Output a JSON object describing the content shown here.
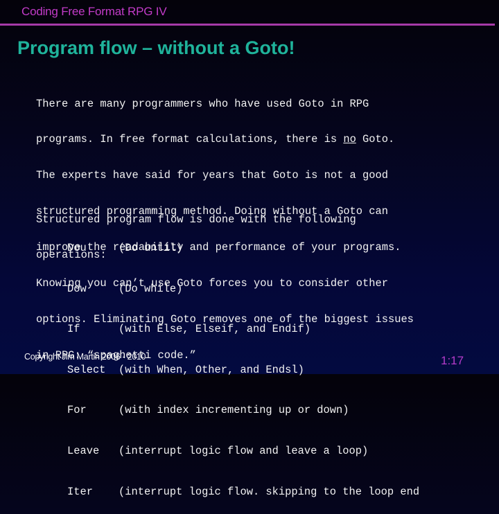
{
  "header": {
    "title": "Coding Free Format RPG IV"
  },
  "slide": {
    "title": "Program flow – without a Goto!",
    "paragraph1": {
      "lines": [
        "There are many programmers who have used Goto in RPG",
        "programs. In free format calculations, there is ",
        "The experts have said for years that Goto is not a good",
        "structured programming method. Doing without a Goto can",
        "improve the readability and performance of your programs.",
        "Knowing you can’t use Goto forces you to consider other",
        "options. Eliminating Goto removes one of the biggest issues",
        "in RPG: “spaghetti code.”"
      ],
      "emphasis_word": "no",
      "line2_tail": " Goto."
    },
    "paragraph2": {
      "lines": [
        "Structured program flow is done with the following",
        "operations:"
      ]
    },
    "operations": [
      {
        "keyword": "Dou",
        "description": "(Do until)"
      },
      {
        "keyword": "Dow",
        "description": "(Do while)"
      },
      {
        "keyword": "If",
        "description": "(with Else, Elseif, and Endif)"
      },
      {
        "keyword": "Select",
        "description": "(with When, Other, and Endsl)"
      },
      {
        "keyword": "For",
        "description": "(with index incrementing up or down)"
      },
      {
        "keyword": "Leave",
        "description": "(interrupt logic flow and leave a loop)"
      },
      {
        "keyword": "Iter",
        "description": "(interrupt logic flow. skipping to the loop end"
      }
    ]
  },
  "footer": {
    "copyright": "Copyright Jim Martin 2006 - 2010",
    "page_number": "1:17"
  },
  "colors": {
    "header_text": "#c23bc8",
    "divider": "#a63aa8",
    "title_text": "#1fb39b",
    "body_text": "#f2f2f2",
    "page_number": "#b63ccc",
    "background_top": "#04020a",
    "background_bottom": "#030a40"
  }
}
